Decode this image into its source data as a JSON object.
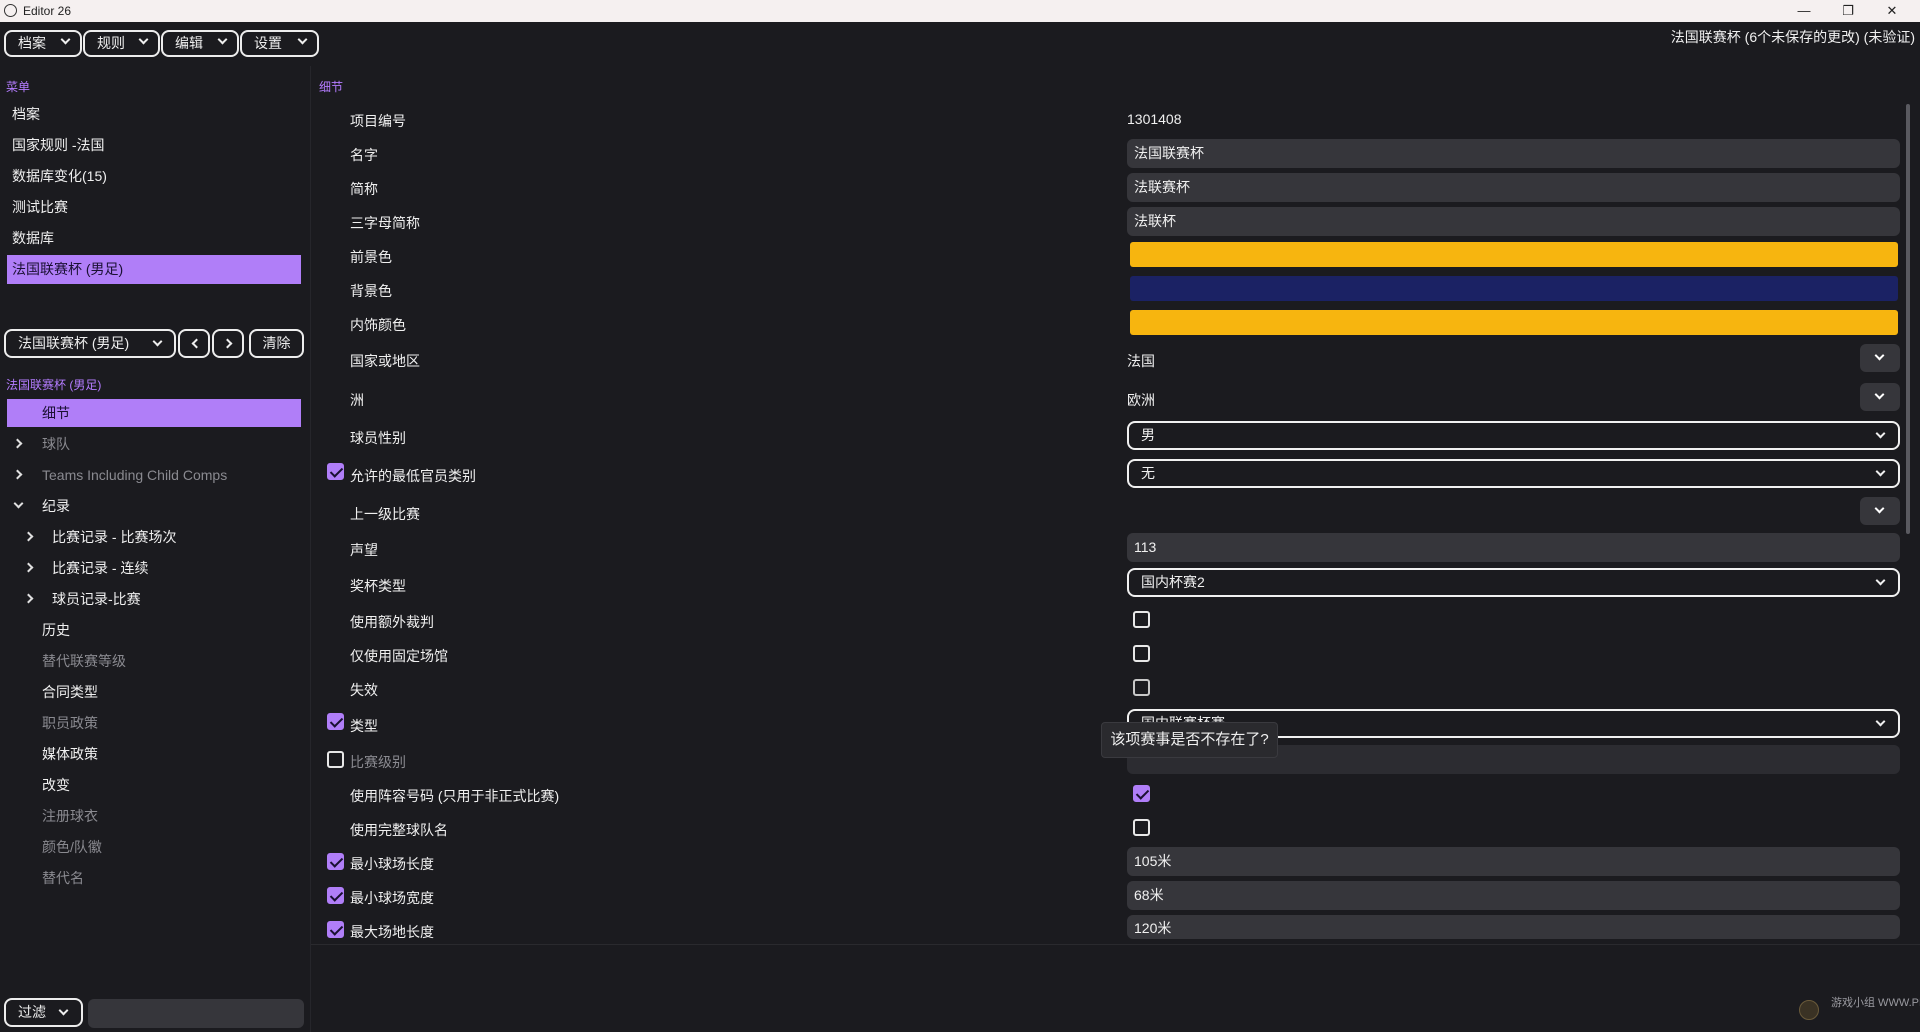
{
  "window": {
    "title": "Editor 26",
    "minimize": "—",
    "maximize": "❐",
    "close": "✕"
  },
  "menubar": {
    "file": "档案",
    "rules": "规则",
    "edit": "编辑",
    "settings": "设置"
  },
  "status_title": "法国联赛杯 (6个未保存的更改) (未验证)",
  "sidebar": {
    "menu_label": "菜单",
    "items": [
      "档案",
      "国家规则 -法国",
      "数据库变化(15)",
      "测试比赛",
      "数据库",
      "法国联赛杯 (男足)"
    ],
    "selector_value": "法国联赛杯 (男足)",
    "clear_label": "清除",
    "tree_label": "法国联赛杯 (男足)",
    "tree": {
      "details": "细节",
      "teams": "球队",
      "teams_child": "Teams Including Child Comps",
      "records": "纪录",
      "rec_match": "比赛记录 - 比赛场次",
      "rec_streak": "比赛记录 - 连续",
      "rec_player": "球员记录-比赛",
      "history": "历史",
      "alt_level": "替代联赛等级",
      "contract": "合同类型",
      "staff_policy": "职员政策",
      "media_policy": "媒体政策",
      "changes": "改变",
      "kit": "注册球衣",
      "colors": "颜色/队徽",
      "alt_name": "替代名"
    },
    "filter_label": "过滤",
    "filter_value": ""
  },
  "main": {
    "section_label": "细节",
    "rows": {
      "id_label": "项目编号",
      "id_value": "1301408",
      "name_label": "名字",
      "name_value": "法国联赛杯",
      "short_label": "简称",
      "short_value": "法联赛杯",
      "three_label": "三字母简称",
      "three_value": "法联杯",
      "fg_label": "前景色",
      "bg_label": "背景色",
      "trim_label": "内饰颜色",
      "nation_label": "国家或地区",
      "nation_value": "法国",
      "continent_label": "洲",
      "continent_value": "欧洲",
      "gender_label": "球员性别",
      "gender_value": "男",
      "official_label": "允许的最低官员类别",
      "official_value": "无",
      "parent_label": "上一级比赛",
      "rep_label": "声望",
      "rep_value": "113",
      "trophy_label": "奖杯类型",
      "trophy_value": "国内杯赛2",
      "extra_ref_label": "使用额外裁判",
      "fixed_stadium_label": "仅使用固定场馆",
      "extinct_label": "失效",
      "type_label": "类型",
      "type_value": "国内联赛杯赛",
      "level_label": "比赛级别",
      "squad_num_label": "使用阵容号码 (只用于非正式比赛)",
      "full_name_label": "使用完整球队名",
      "min_len_label": "最小球场长度",
      "min_len_value": "105米",
      "min_wid_label": "最小球场宽度",
      "min_wid_value": "68米",
      "max_len_label": "最大场地长度",
      "max_len_value": "120米"
    },
    "tooltip": "该项赛事是否不存在了?"
  },
  "colors": {
    "foreground": "#f7b50f",
    "background": "#1b2264",
    "trim": "#f7b50f",
    "accent": "#b07ef8"
  },
  "watermark": "游戏小组 WWW.PLAYGM.CC"
}
